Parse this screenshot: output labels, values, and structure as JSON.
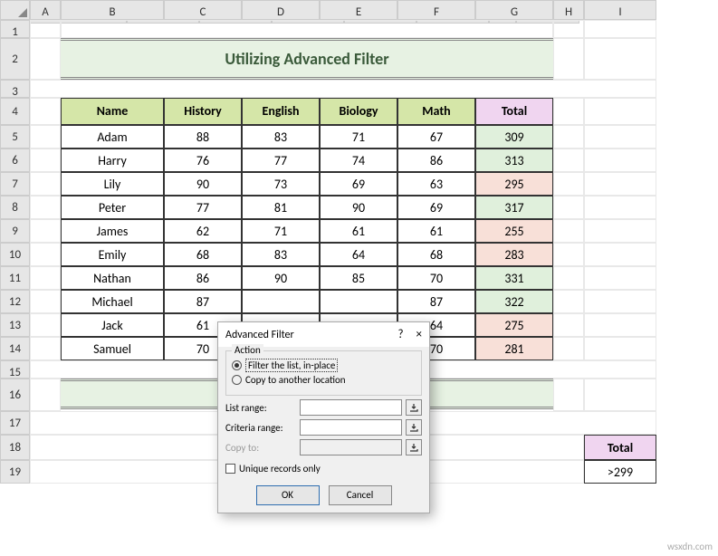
{
  "cols": [
    "A",
    "B",
    "C",
    "D",
    "E",
    "F",
    "G",
    "H",
    "I"
  ],
  "rows": [
    "1",
    "2",
    "3",
    "4",
    "5",
    "6",
    "7",
    "8",
    "9",
    "10",
    "11",
    "12",
    "13",
    "14",
    "15",
    "16",
    "17",
    "18",
    "19"
  ],
  "title": "Utilizing Advanced Filter",
  "headers": {
    "name": "Name",
    "history": "History",
    "english": "English",
    "biology": "Biology",
    "math": "Math",
    "total": "Total"
  },
  "data": [
    {
      "name": "Adam",
      "history": "88",
      "english": "83",
      "biology": "71",
      "math": "67",
      "total": "309",
      "cls": "total-green"
    },
    {
      "name": "Harry",
      "history": "76",
      "english": "77",
      "biology": "74",
      "math": "86",
      "total": "313",
      "cls": "total-green"
    },
    {
      "name": "Lily",
      "history": "90",
      "english": "73",
      "biology": "69",
      "math": "63",
      "total": "295",
      "cls": "total-red"
    },
    {
      "name": "Peter",
      "history": "77",
      "english": "81",
      "biology": "90",
      "math": "69",
      "total": "317",
      "cls": "total-green"
    },
    {
      "name": "James",
      "history": "62",
      "english": "71",
      "biology": "61",
      "math": "61",
      "total": "255",
      "cls": "total-red"
    },
    {
      "name": "Emily",
      "history": "68",
      "english": "83",
      "biology": "64",
      "math": "68",
      "total": "283",
      "cls": "total-red"
    },
    {
      "name": "Nathan",
      "history": "86",
      "english": "90",
      "biology": "85",
      "math": "70",
      "total": "331",
      "cls": "total-green"
    },
    {
      "name": "Michael",
      "history": "87",
      "english": "",
      "biology": "",
      "math": "87",
      "total": "322",
      "cls": "total-green"
    },
    {
      "name": "Jack",
      "history": "61",
      "english": "",
      "biology": "",
      "math": "64",
      "total": "275",
      "cls": "total-red"
    },
    {
      "name": "Samuel",
      "history": "70",
      "english": "",
      "biology": "",
      "math": "70",
      "total": "281",
      "cls": "total-red"
    }
  ],
  "criteria": {
    "header": "Total",
    "value": ">299"
  },
  "dialog": {
    "title": "Advanced Filter",
    "help": "?",
    "close": "×",
    "action_legend": "Action",
    "radio1": "Filter the list, in-place",
    "radio2": "Copy to another location",
    "list_range": "List range:",
    "criteria_range": "Criteria range:",
    "copy_to": "Copy to:",
    "unique": "Unique records only",
    "ok": "OK",
    "cancel": "Cancel"
  },
  "watermark": "wsxdn.com"
}
